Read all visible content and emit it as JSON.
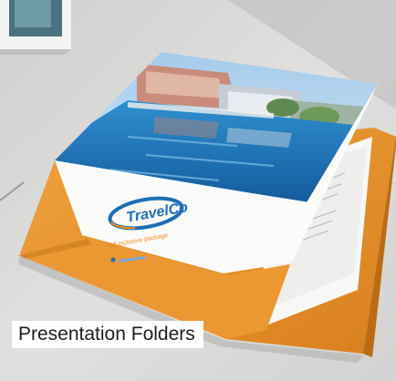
{
  "product": {
    "caption": "Presentation Folders",
    "folder_color": "#e8962e",
    "brand_color": "#1f6fb4",
    "accent_color": "#f08a1c"
  },
  "brand": {
    "logo_text": "TravelCo",
    "tagline": "all inclusive package"
  }
}
